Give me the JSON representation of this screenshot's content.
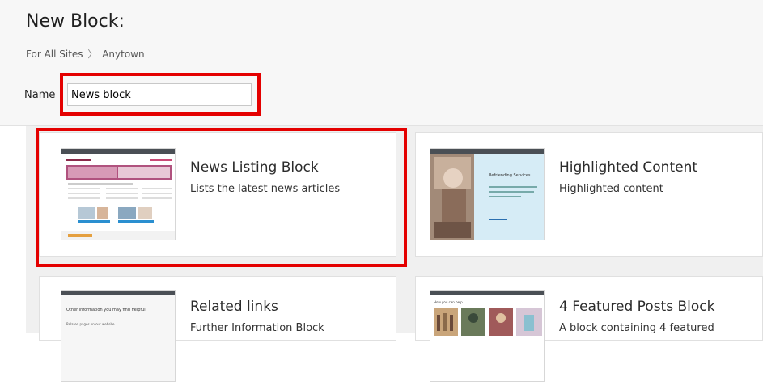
{
  "header": {
    "title": "New Block:",
    "breadcrumb": {
      "root": "For All Sites",
      "separator": "〉",
      "current": "Anytown"
    },
    "name_label": "Name",
    "name_value": "News block"
  },
  "blocks": [
    {
      "title": "News Listing Block",
      "description": "Lists the latest news articles",
      "icon": "news-listing-thumbnail",
      "highlighted": true
    },
    {
      "title": "Highlighted Content",
      "description": "Highlighted content",
      "icon": "highlighted-content-thumbnail",
      "highlighted": false
    },
    {
      "title": "Related links",
      "description": "Further Information Block",
      "icon": "related-links-thumbnail",
      "highlighted": false
    },
    {
      "title": "4 Featured Posts Block",
      "description": "A block containing 4 featured",
      "icon": "featured-posts-thumbnail",
      "highlighted": false
    }
  ],
  "thumb_text": {
    "highlighted_heading": "Befriending Services",
    "related_heading": "Other information you may find helpful",
    "related_sub": "Related pages on our website",
    "featured_heading": "How you can help"
  },
  "colors": {
    "highlight_border": "#e40000",
    "thumb_bar": "#4a4f55",
    "panel_bg": "#f0f0f0"
  }
}
